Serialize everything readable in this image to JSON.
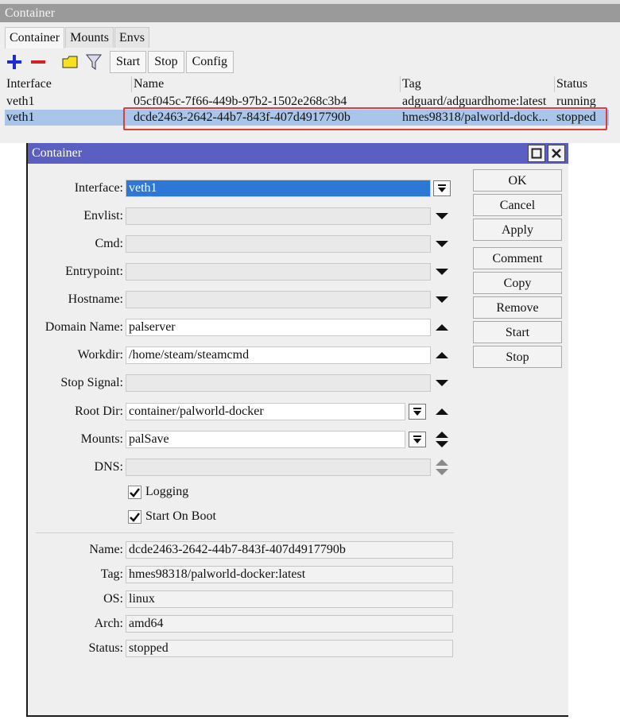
{
  "top_window": {
    "title": "Container",
    "tabs": [
      "Container",
      "Mounts",
      "Envs"
    ],
    "toolbar": {
      "icons": [
        "add-icon",
        "remove-icon",
        "comment-icon",
        "filter-icon"
      ],
      "buttons": [
        "Start",
        "Stop",
        "Config"
      ]
    },
    "table": {
      "columns": [
        "Interface",
        "Name",
        "Tag",
        "Status"
      ],
      "rows": [
        {
          "interface": "veth1",
          "name": "05cf045c-7f66-449b-97b2-1502e268c3b4",
          "tag": "adguard/adguardhome:latest",
          "status": "running"
        },
        {
          "interface": "veth1",
          "name": "dcde2463-2642-44b7-843f-407d4917790b",
          "tag": "hmes98318/palworld-dock...",
          "status": "stopped"
        }
      ],
      "selected_row": 1
    }
  },
  "dialog": {
    "title": "Container",
    "fields": {
      "interface": {
        "label": "Interface:",
        "value": "veth1"
      },
      "envlist": {
        "label": "Envlist:",
        "value": ""
      },
      "cmd": {
        "label": "Cmd:",
        "value": ""
      },
      "entrypoint": {
        "label": "Entrypoint:",
        "value": ""
      },
      "hostname": {
        "label": "Hostname:",
        "value": ""
      },
      "domain_name": {
        "label": "Domain Name:",
        "value": "palserver"
      },
      "workdir": {
        "label": "Workdir:",
        "value": "/home/steam/steamcmd"
      },
      "stop_signal": {
        "label": "Stop Signal:",
        "value": ""
      },
      "root_dir": {
        "label": "Root Dir:",
        "value": "container/palworld-docker"
      },
      "mounts": {
        "label": "Mounts:",
        "value": "palSave"
      },
      "dns": {
        "label": "DNS:",
        "value": ""
      }
    },
    "checkboxes": {
      "logging": {
        "label": "Logging",
        "checked": true
      },
      "start_on_boot": {
        "label": "Start On Boot",
        "checked": true
      }
    },
    "info": {
      "name": {
        "label": "Name:",
        "value": "dcde2463-2642-44b7-843f-407d4917790b"
      },
      "tag": {
        "label": "Tag:",
        "value": "hmes98318/palworld-docker:latest"
      },
      "os": {
        "label": "OS:",
        "value": "linux"
      },
      "arch": {
        "label": "Arch:",
        "value": "amd64"
      },
      "status": {
        "label": "Status:",
        "value": "stopped"
      }
    },
    "buttons": {
      "ok": "OK",
      "cancel": "Cancel",
      "apply": "Apply",
      "comment": "Comment",
      "copy": "Copy",
      "remove": "Remove",
      "start": "Start",
      "stop": "Stop"
    }
  },
  "colors": {
    "dialog_titlebar": "#5c5fc2",
    "selection": "#a9c6ea",
    "highlight_input": "#2d77d6",
    "annotation_box": "#e23b3b"
  }
}
